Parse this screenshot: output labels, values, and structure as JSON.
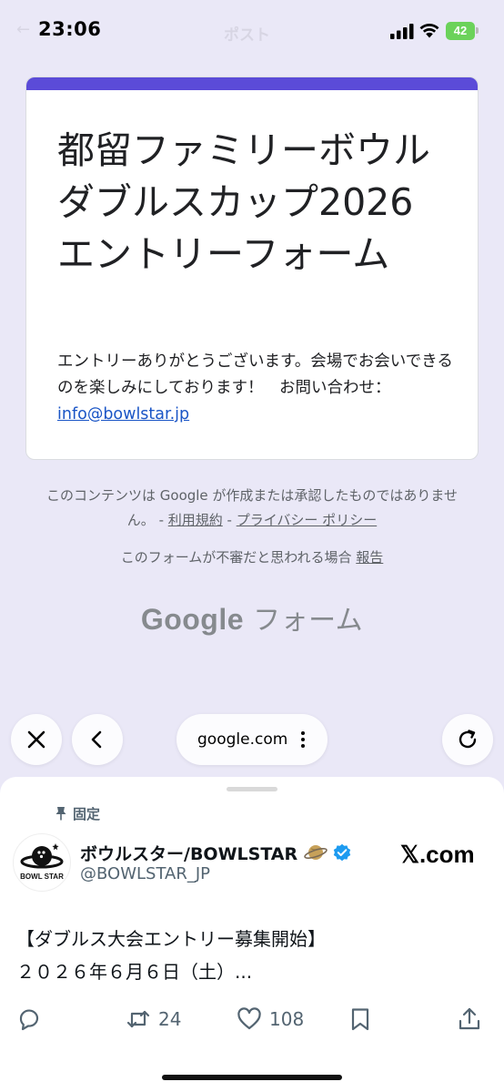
{
  "status_bar": {
    "time": "23:06",
    "battery": "42",
    "ghost_title": "ポスト"
  },
  "form": {
    "title": "都留ファミリーボウルダブルスカップ2026 エントリーフォーム",
    "description": "エントリーありがとうございます。会場でお会いできるのを楽しみにしております！　お問い合わせ：",
    "email": "info@bowlstar.jp",
    "accent_color": "#5b4bd8"
  },
  "footer": {
    "disclaimer": "このコンテンツは Google が作成または承認したものではありません。 - ",
    "terms": "利用規約",
    "sep": " - ",
    "privacy": "プライバシー ポリシー",
    "report_prefix": "このフォームが不審だと思われる場合 ",
    "report_link": "報告",
    "brand_google": "Google",
    "brand_forms": "フォーム"
  },
  "toolbar": {
    "close_icon": "close-icon",
    "back_icon": "chevron-left-icon",
    "url": "google.com",
    "reload_icon": "reload-icon"
  },
  "tweet": {
    "pinned_label": "固定",
    "display_name": "ボウルスター/BOWLSTAR",
    "username": "@BOWLSTAR_JP",
    "site": "𝕏.com",
    "avatar_text": "BOWL STAR",
    "line1": "【ダブルス大会エントリー募集開始】",
    "line2": "２０２６年６月６日（土）...",
    "retweets": "24",
    "likes": "108"
  }
}
